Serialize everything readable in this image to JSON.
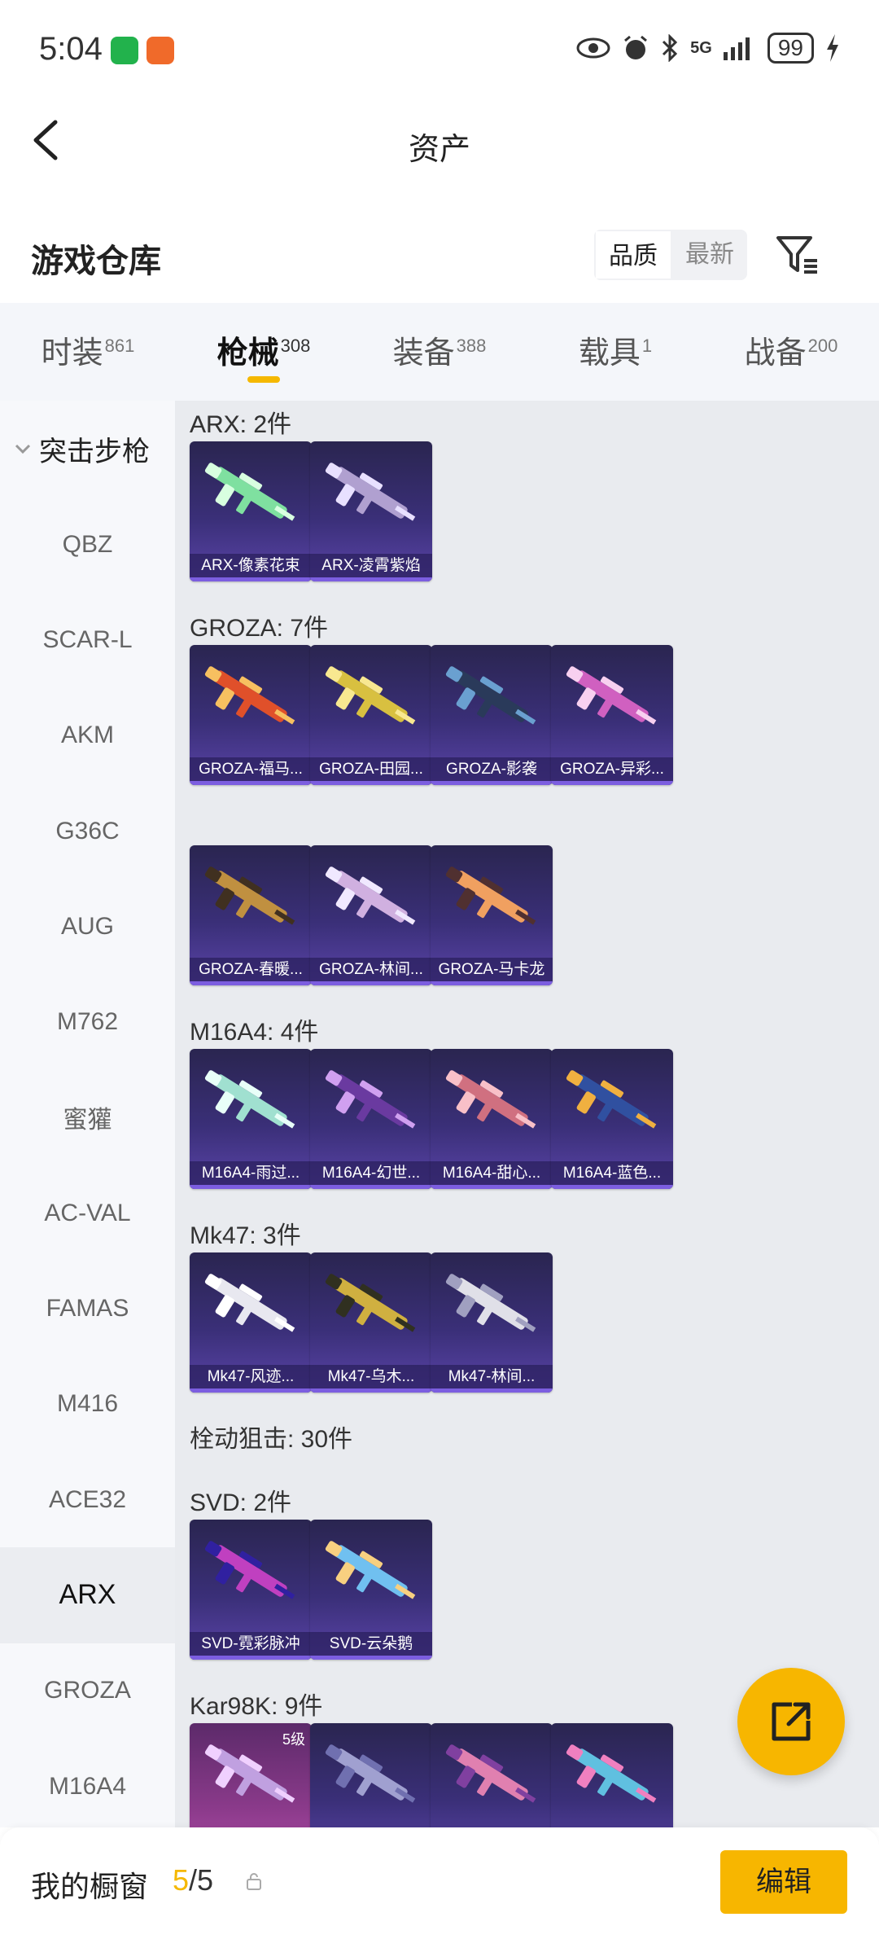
{
  "status_bar": {
    "time": "5:04",
    "battery": "99",
    "network": "5G"
  },
  "header": {
    "title": "资产"
  },
  "warehouse": {
    "title": "游戏仓库",
    "sort_options": [
      "品质",
      "最新"
    ],
    "active_sort": "品质"
  },
  "tabs": [
    {
      "label": "时装",
      "count": "861"
    },
    {
      "label": "枪械",
      "count": "308"
    },
    {
      "label": "装备",
      "count": "388"
    },
    {
      "label": "载具",
      "count": "1"
    },
    {
      "label": "战备",
      "count": "200"
    }
  ],
  "sidebar": {
    "group": "突击步枪",
    "items": [
      "QBZ",
      "SCAR-L",
      "AKM",
      "G36C",
      "AUG",
      "M762",
      "蜜獾",
      "AC-VAL",
      "FAMAS",
      "M416",
      "ACE32",
      "ARX",
      "GROZA",
      "M16A4"
    ],
    "active": "ARX"
  },
  "sections": [
    {
      "label": "ARX: 2件",
      "items": [
        "ARX-像素花束",
        "ARX-凌霄紫焰"
      ]
    },
    {
      "label": "GROZA: 7件",
      "items": [
        "GROZA-福马...",
        "GROZA-田园...",
        "GROZA-影袭",
        "GROZA-异彩...",
        "GROZA-春暖...",
        "GROZA-林间...",
        "GROZA-马卡龙"
      ]
    },
    {
      "label": "M16A4: 4件",
      "items": [
        "M16A4-雨过...",
        "M16A4-幻世...",
        "M16A4-甜心...",
        "M16A4-蓝色..."
      ]
    },
    {
      "label": "Mk47: 3件",
      "items": [
        "Mk47-风迹...",
        "Mk47-乌木...",
        "Mk47-林间..."
      ]
    },
    {
      "label": "栓动狙击: 30件",
      "items": []
    },
    {
      "label": "SVD: 2件",
      "items": [
        "SVD-霓彩脉冲",
        "SVD-云朵鹅"
      ]
    },
    {
      "label": "Kar98K: 9件",
      "items": [],
      "first_level": "5级"
    }
  ],
  "bottom_bar": {
    "label": "我的橱窗",
    "count_current": "5",
    "count_total": "/5",
    "edit_label": "编辑"
  },
  "colors": {
    "accent": "#f7b600",
    "card_bg": "#3a2f78",
    "card_border": "#7c5ee0"
  }
}
